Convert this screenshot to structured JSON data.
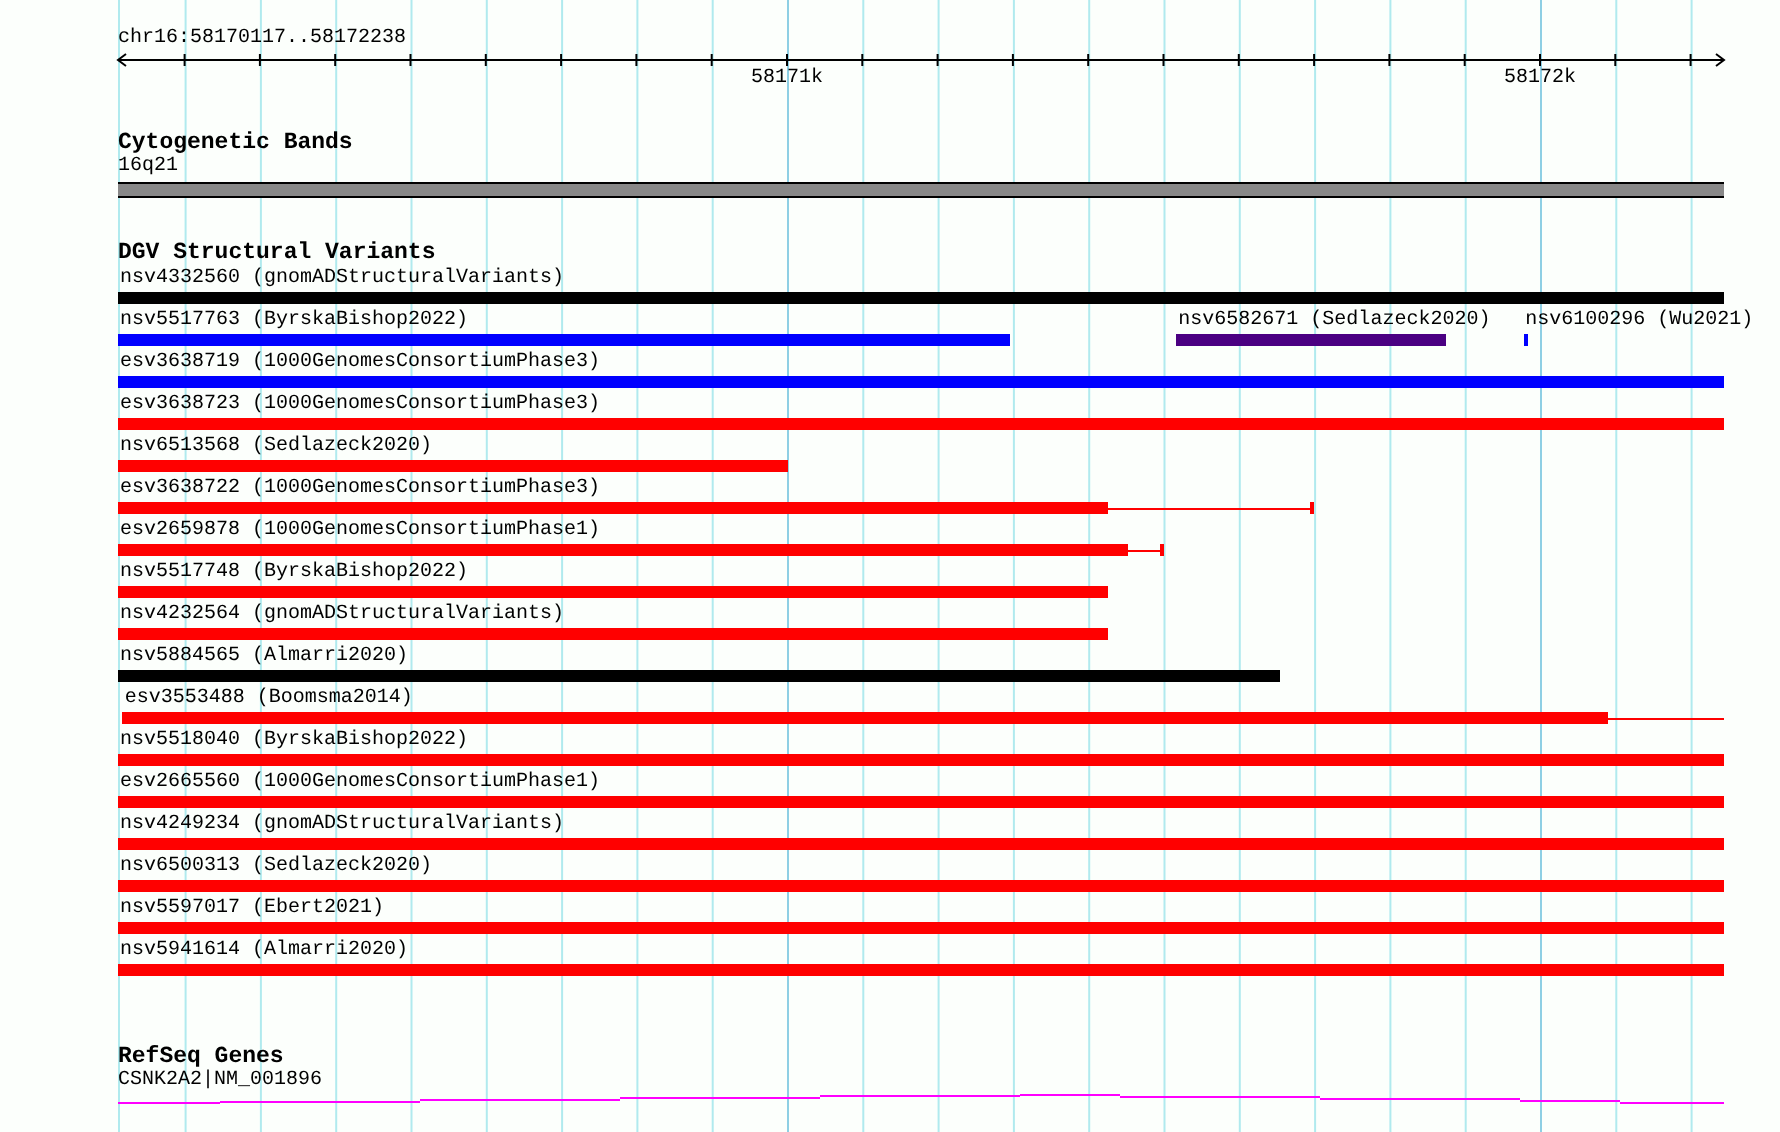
{
  "ruler": {
    "position": "chr16:58170117..58172238",
    "tick_labels": [
      "58171k",
      "58172k"
    ]
  },
  "tracks": [
    {
      "kind": "band",
      "title": "Cytogenetic Bands",
      "band_label": "16q21"
    },
    {
      "kind": "variants",
      "title": "DGV Structural Variants",
      "rows": [
        {
          "features": [
            {
              "label": "nsv4332560 (gnomADStructuralVariants)",
              "color": "#000000",
              "kind": "plain"
            }
          ]
        },
        {
          "features": [
            {
              "label": "nsv5517763 (ByrskaBishop2022)",
              "color": "#0000ff",
              "kind": "plain"
            },
            {
              "label": "nsv6582671 (Sedlazeck2020)",
              "color": "#4b0082",
              "kind": "plain"
            },
            {
              "label": "nsv6100296 (Wu2021)",
              "color": "#0000ff",
              "kind": "plain"
            }
          ]
        },
        {
          "features": [
            {
              "label": "esv3638719 (1000GenomesConsortiumPhase3)",
              "color": "#0000ff",
              "kind": "plain"
            }
          ]
        },
        {
          "features": [
            {
              "label": "esv3638723 (1000GenomesConsortiumPhase3)",
              "color": "#ff0000",
              "kind": "plain"
            }
          ]
        },
        {
          "features": [
            {
              "label": "nsv6513568 (Sedlazeck2020)",
              "color": "#ff0000",
              "kind": "plain"
            }
          ]
        },
        {
          "features": [
            {
              "label": "esv3638722 (1000GenomesConsortiumPhase3)",
              "color": "#ff0000",
              "kind": "whisker_ticked"
            }
          ]
        },
        {
          "features": [
            {
              "label": "esv2659878 (1000GenomesConsortiumPhase1)",
              "color": "#ff0000",
              "kind": "whisker_ticked"
            }
          ]
        },
        {
          "features": [
            {
              "label": "nsv5517748 (ByrskaBishop2022)",
              "color": "#ff0000",
              "kind": "plain"
            }
          ]
        },
        {
          "features": [
            {
              "label": "nsv4232564 (gnomADStructuralVariants)",
              "color": "#ff0000",
              "kind": "plain"
            }
          ]
        },
        {
          "features": [
            {
              "label": "nsv5884565 (Almarri2020)",
              "color": "#000000",
              "kind": "plain"
            }
          ]
        },
        {
          "features": [
            {
              "label": "esv3553488 (Boomsma2014)",
              "color": "#ff0000",
              "kind": "whisker_open"
            }
          ]
        },
        {
          "features": [
            {
              "label": "nsv5518040 (ByrskaBishop2022)",
              "color": "#ff0000",
              "kind": "plain"
            }
          ]
        },
        {
          "features": [
            {
              "label": "esv2665560 (1000GenomesConsortiumPhase1)",
              "color": "#ff0000",
              "kind": "plain"
            }
          ]
        },
        {
          "features": [
            {
              "label": "nsv4249234 (gnomADStructuralVariants)",
              "color": "#ff0000",
              "kind": "plain"
            }
          ]
        },
        {
          "features": [
            {
              "label": "nsv6500313 (Sedlazeck2020)",
              "color": "#ff0000",
              "kind": "plain"
            }
          ]
        },
        {
          "features": [
            {
              "label": "nsv5597017 (Ebert2021)",
              "color": "#ff0000",
              "kind": "plain"
            }
          ]
        },
        {
          "features": [
            {
              "label": "nsv5941614 (Almarri2020)",
              "color": "#ff0000",
              "kind": "plain"
            }
          ]
        }
      ]
    },
    {
      "kind": "gene",
      "title": "RefSeq Genes",
      "gene_label": "CSNK2A2|NM_001896"
    }
  ]
}
